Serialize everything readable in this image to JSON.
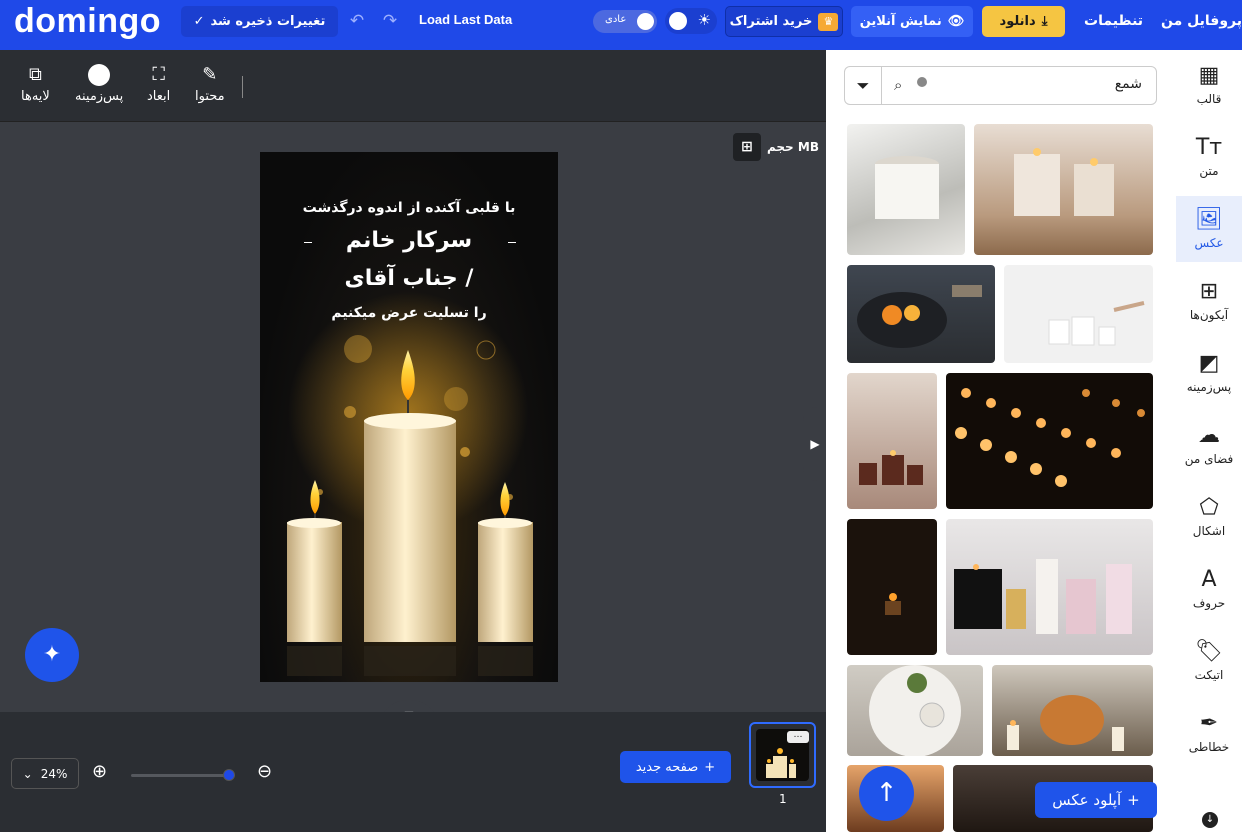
{
  "app": {
    "logo": "domingo"
  },
  "topbar": {
    "saved_label": "تغییرات ذخیره شد",
    "load_last": "Load Last Data",
    "mode_label": "عادی",
    "subscribe_label": "خرید اشتراک",
    "live_preview_label": "نمایش آنلاین",
    "download_label": "دانلود",
    "settings_label": "تنظیمات",
    "profile_label": "پروفایل من",
    "colors": {
      "bar": "#1f49e8",
      "download": "#f5c542",
      "crown": "#f6a935"
    }
  },
  "rail": {
    "items": [
      {
        "label": "قالب",
        "icon": "layout-icon"
      },
      {
        "label": "متن",
        "icon": "text-icon"
      },
      {
        "label": "عکس",
        "icon": "image-icon",
        "active": true
      },
      {
        "label": "آیکون‌ها",
        "icon": "grid-icon"
      },
      {
        "label": "پس‌زمینه",
        "icon": "background-icon"
      },
      {
        "label": "فضای من",
        "icon": "cloud-upload-icon"
      },
      {
        "label": "اشکال",
        "icon": "shapes-icon"
      },
      {
        "label": "حروف",
        "icon": "letters-icon"
      },
      {
        "label": "اتیکت",
        "icon": "tag-icon"
      },
      {
        "label": "خطاطی",
        "icon": "feather-icon"
      }
    ]
  },
  "panel": {
    "search_value": "شمع",
    "upload_label": "آپلود عکس"
  },
  "toolbar": {
    "content_label": "محتوا",
    "dimensions_label": "ابعاد",
    "background_label": "پس‌زمینه",
    "layers_label": "لایه‌ها"
  },
  "canvas": {
    "size_label": "حجم MB",
    "poster": {
      "line1": "با قلبی آکنده از اندوه درگذشت",
      "line2": "سرکار خانم",
      "line3": "/ جناب آقای",
      "line4": "را تسلیت عرض میکنیم"
    }
  },
  "bottom": {
    "zoom": "24%",
    "zoom_level": 0.24,
    "new_page_label": "صفحه جدید",
    "page_number": "1"
  }
}
